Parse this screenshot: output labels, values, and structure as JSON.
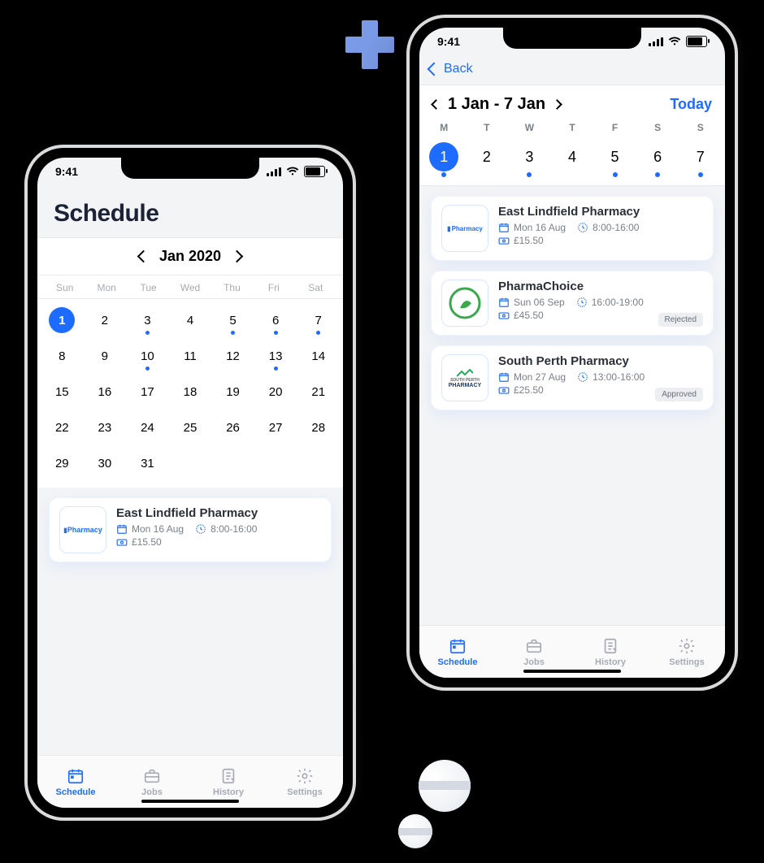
{
  "statusbar": {
    "time": "9:41"
  },
  "phoneA": {
    "title": "Schedule",
    "month_label": "Jan 2020",
    "weekday_headers": [
      "Sun",
      "Mon",
      "Tue",
      "Wed",
      "Thu",
      "Fri",
      "Sat"
    ],
    "days": [
      {
        "n": "1",
        "sel": true,
        "dot": true
      },
      {
        "n": "2"
      },
      {
        "n": "3",
        "dot": true
      },
      {
        "n": "4"
      },
      {
        "n": "5",
        "dot": true
      },
      {
        "n": "6",
        "dot": true
      },
      {
        "n": "7",
        "dot": true
      },
      {
        "n": "8"
      },
      {
        "n": "9"
      },
      {
        "n": "10",
        "dot": true
      },
      {
        "n": "11"
      },
      {
        "n": "12"
      },
      {
        "n": "13",
        "dot": true
      },
      {
        "n": "14"
      },
      {
        "n": "15"
      },
      {
        "n": "16"
      },
      {
        "n": "17"
      },
      {
        "n": "18"
      },
      {
        "n": "19"
      },
      {
        "n": "20"
      },
      {
        "n": "21"
      },
      {
        "n": "22"
      },
      {
        "n": "23"
      },
      {
        "n": "24"
      },
      {
        "n": "25"
      },
      {
        "n": "26"
      },
      {
        "n": "27"
      },
      {
        "n": "28"
      },
      {
        "n": "29"
      },
      {
        "n": "30"
      },
      {
        "n": "31"
      }
    ],
    "job": {
      "name": "East Lindfield Pharmacy",
      "logo_text": "Pharmacy",
      "date": "Mon 16 Aug",
      "time": "8:00-16:00",
      "rate": "£15.50"
    }
  },
  "phoneB": {
    "back_label": "Back",
    "range_label": "1 Jan - 7 Jan",
    "today_label": "Today",
    "dow": [
      "M",
      "T",
      "W",
      "T",
      "F",
      "S",
      "S"
    ],
    "week": [
      {
        "n": "1",
        "sel": true,
        "dot": true
      },
      {
        "n": "2"
      },
      {
        "n": "3",
        "dot": true
      },
      {
        "n": "4"
      },
      {
        "n": "5",
        "dot": true
      },
      {
        "n": "6",
        "dot": true
      },
      {
        "n": "7",
        "dot": true
      }
    ],
    "jobs": [
      {
        "name": "East Lindfield Pharmacy",
        "logo_text": "Pharmacy",
        "logo_color": "#1E6CFF",
        "date": "Mon 16 Aug",
        "time": "8:00-16:00",
        "rate": "£15.50",
        "status": ""
      },
      {
        "name": "PharmaChoice",
        "logo_text": "",
        "logo_color": "#3AA84C",
        "date": "Sun 06 Sep",
        "time": "16:00-19:00",
        "rate": "£45.50",
        "status": "Rejected"
      },
      {
        "name": "South Perth Pharmacy",
        "logo_text": "PHARMACY",
        "logo_color": "#1B3A6B",
        "date": "Mon 27 Aug",
        "time": "13:00-16:00",
        "rate": "£25.50",
        "status": "Approved"
      }
    ]
  },
  "tabs": [
    {
      "label": "Schedule",
      "icon": "calendar",
      "active": true
    },
    {
      "label": "Jobs",
      "icon": "briefcase"
    },
    {
      "label": "History",
      "icon": "history"
    },
    {
      "label": "Settings",
      "icon": "gear"
    }
  ]
}
